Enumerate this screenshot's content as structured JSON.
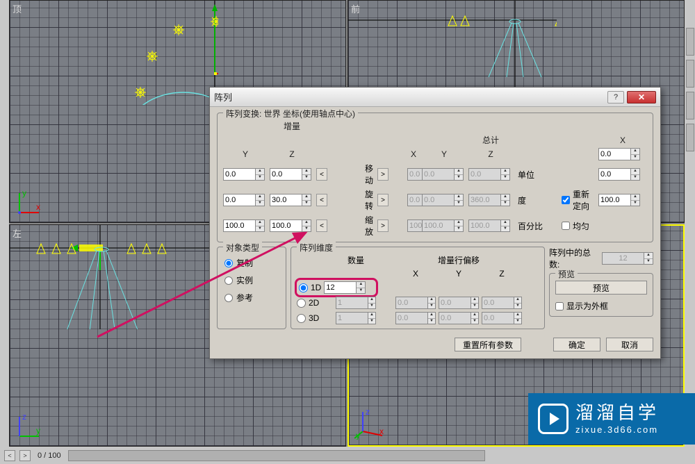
{
  "viewports": {
    "top": "顶",
    "front": "前",
    "left": "左"
  },
  "dialog": {
    "title": "阵列",
    "group_transform": "阵列变换: 世界 坐标(使用轴点中心)",
    "sub_increment": "增量",
    "sub_total": "总计",
    "axis_x": "X",
    "axis_y": "Y",
    "axis_z": "Z",
    "op_move": "移动",
    "op_rotate": "旋转",
    "op_scale": "缩放",
    "unit_unit": "单位",
    "unit_degree": "度",
    "unit_percent": "百分比",
    "chk_reorient": "重新定向",
    "chk_uniform": "均匀",
    "move": {
      "ix": "0.0",
      "iy": "0.0",
      "iz": "0.0",
      "tx": "0.0",
      "ty": "0.0",
      "tz": "0.0"
    },
    "rotate": {
      "ix": "0.0",
      "iy": "0.0",
      "iz": "30.0",
      "tx": "0.0",
      "ty": "0.0",
      "tz": "360.0"
    },
    "scale": {
      "ix": "100.0",
      "iy": "100.0",
      "iz": "100.0",
      "tx": "100.0",
      "ty": "100.0",
      "tz": "100.0"
    },
    "group_objtype": "对象类型",
    "radio_copy": "复制",
    "radio_instance": "实例",
    "radio_reference": "参考",
    "group_dim": "阵列维度",
    "dim_count": "数量",
    "dim_offset": "增量行偏移",
    "dim_1d": "1D",
    "dim_2d": "2D",
    "dim_3d": "3D",
    "count_1d": "12",
    "count_2d": "1",
    "count_3d": "1",
    "off2": {
      "x": "0.0",
      "y": "0.0",
      "z": "0.0"
    },
    "off3": {
      "x": "0.0",
      "y": "0.0",
      "z": "0.0"
    },
    "total_label": "阵列中的总数:",
    "total_value": "12",
    "group_preview": "预览",
    "btn_preview": "预览",
    "chk_wireframe": "显示为外框",
    "btn_reset": "重置所有参数",
    "btn_ok": "确定",
    "btn_cancel": "取消"
  },
  "bottom": {
    "frame": "0 / 100"
  },
  "watermark": {
    "main": "溜溜自学",
    "sub": "zixue.3d66.com"
  }
}
